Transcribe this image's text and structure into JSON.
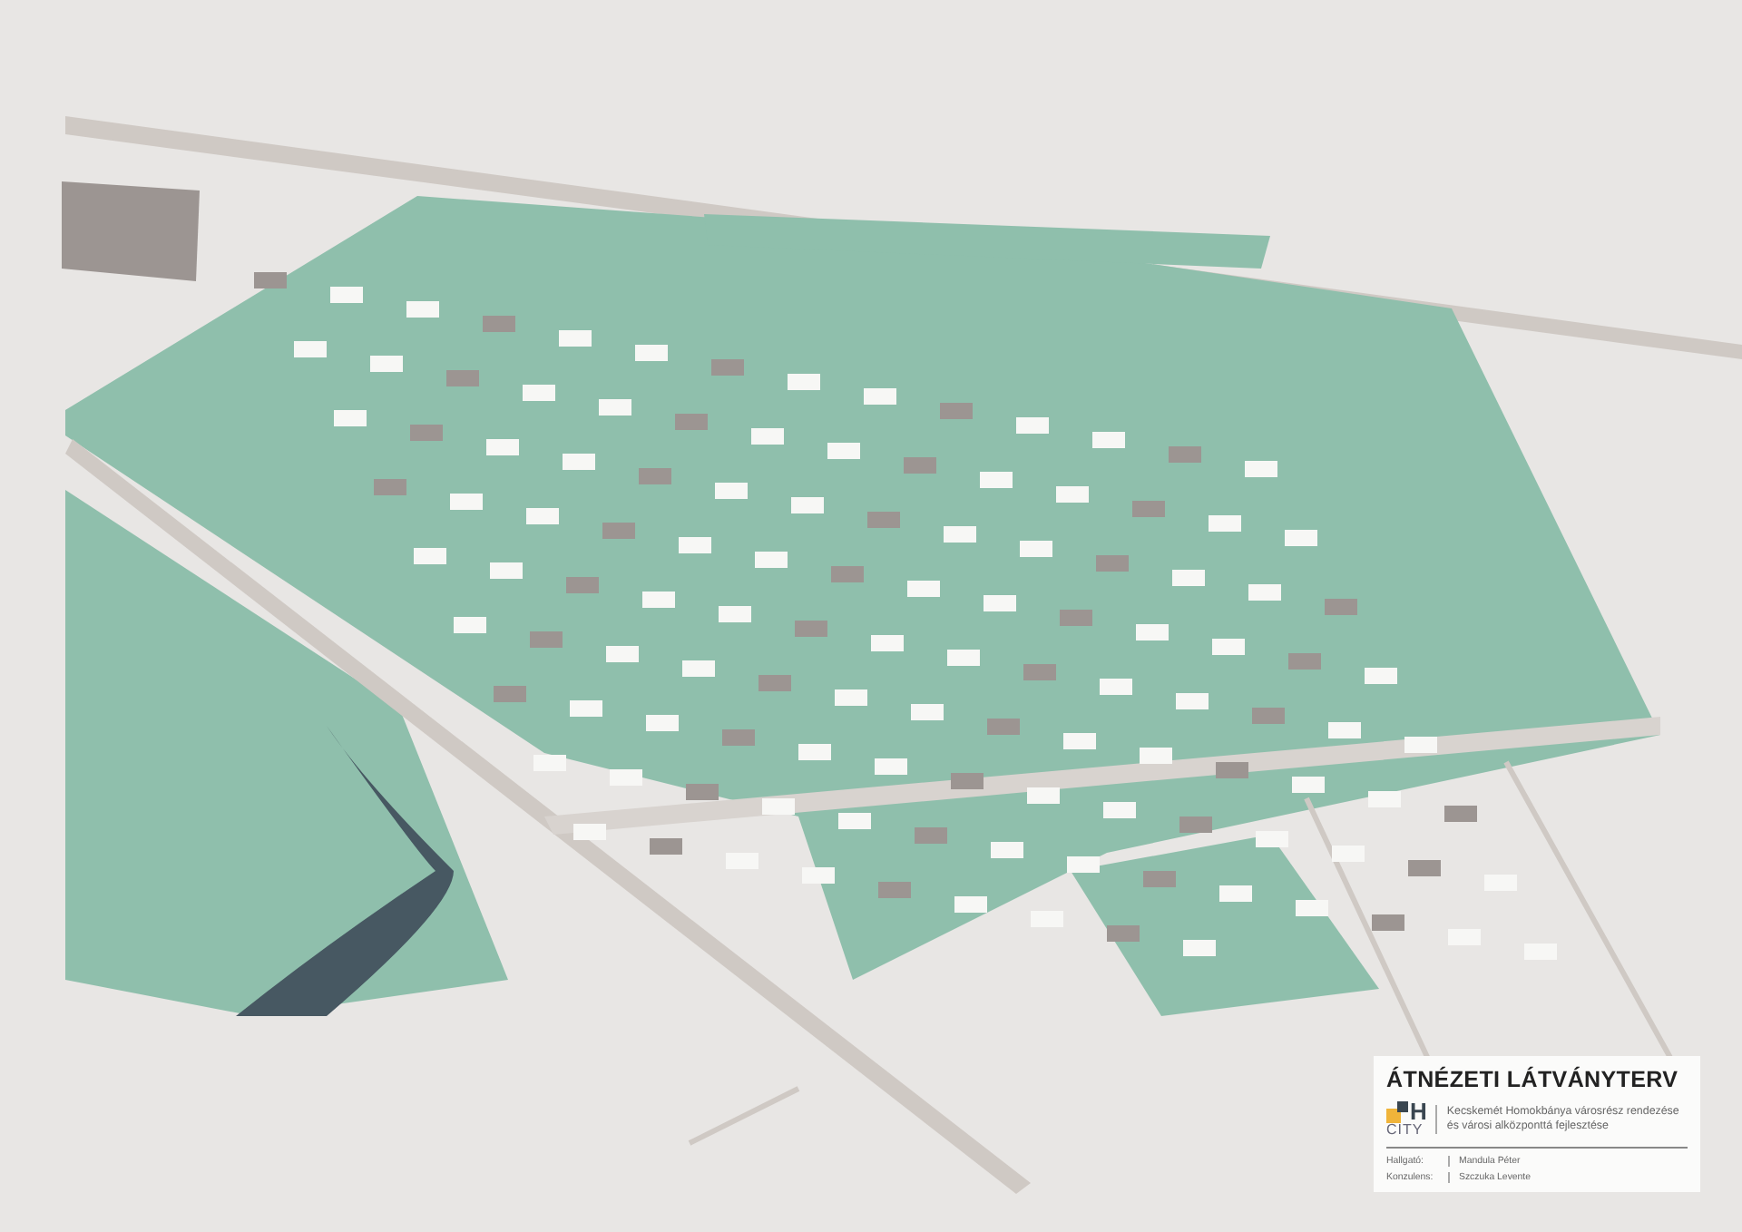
{
  "title_block": {
    "title": "ÁTNÉZETI LÁTVÁNYTERV",
    "logo": {
      "letter": "H",
      "word": "CITY"
    },
    "subtitle": "Kecskemét Homokbánya városrész rendezése és városi alközponttá fejlesztése",
    "credits": [
      {
        "role": "Hallgató:",
        "name": "Mandula Péter"
      },
      {
        "role": "Konzulens:",
        "name": "Szczuka Levente"
      }
    ]
  }
}
